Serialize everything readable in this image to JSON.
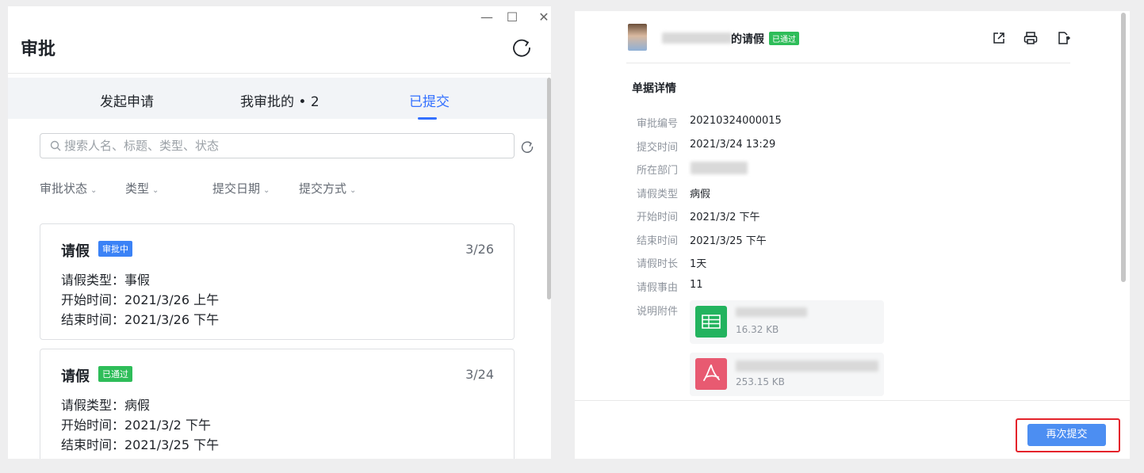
{
  "left_window": {
    "title": "审批",
    "controls": [
      "—",
      "☐",
      "✕"
    ],
    "tabs": [
      {
        "label": "发起申请"
      },
      {
        "label": "我审批的 • 2"
      },
      {
        "label": "已提交"
      }
    ],
    "active_tab": "已提交",
    "search": {
      "placeholder": "搜索人名、标题、类型、状态"
    },
    "filters": [
      "审批状态",
      "类型",
      "提交日期",
      "提交方式"
    ],
    "cards": [
      {
        "title": "请假",
        "status": "审批中",
        "date": "3/26",
        "rows": [
          "请假类型：事假",
          "开始时间：2021/3/26 上午",
          "结束时间：2021/3/26 下午"
        ]
      },
      {
        "title": "请假",
        "status": "已通过",
        "date": "3/24",
        "rows": [
          "请假类型：病假",
          "开始时间：2021/3/2 下午",
          "结束时间：2021/3/25 下午"
        ]
      }
    ]
  },
  "right_window": {
    "header_title": "的请假",
    "header_badge": "已通过",
    "section_title": "单据详情",
    "fields": [
      {
        "label": "审批编号",
        "value": "20210324000015"
      },
      {
        "label": "提交时间",
        "value": "2021/3/24 13:29"
      },
      {
        "label": "所在部门",
        "value": ""
      },
      {
        "label": "请假类型",
        "value": "病假"
      },
      {
        "label": "开始时间",
        "value": "2021/3/2 下午"
      },
      {
        "label": "结束时间",
        "value": "2021/3/25 下午"
      },
      {
        "label": "请假时长",
        "value": "1天"
      },
      {
        "label": "请假事由",
        "value": "11"
      }
    ],
    "attachments_label": "说明附件",
    "attachments": [
      {
        "type": "spreadsheet",
        "size": "16.32 KB"
      },
      {
        "type": "pdf",
        "size": "253.15 KB"
      }
    ],
    "resubmit_label": "再次提交"
  },
  "colors": {
    "accent": "#3370ff",
    "success": "#2ebd59",
    "danger": "#e4232b"
  }
}
